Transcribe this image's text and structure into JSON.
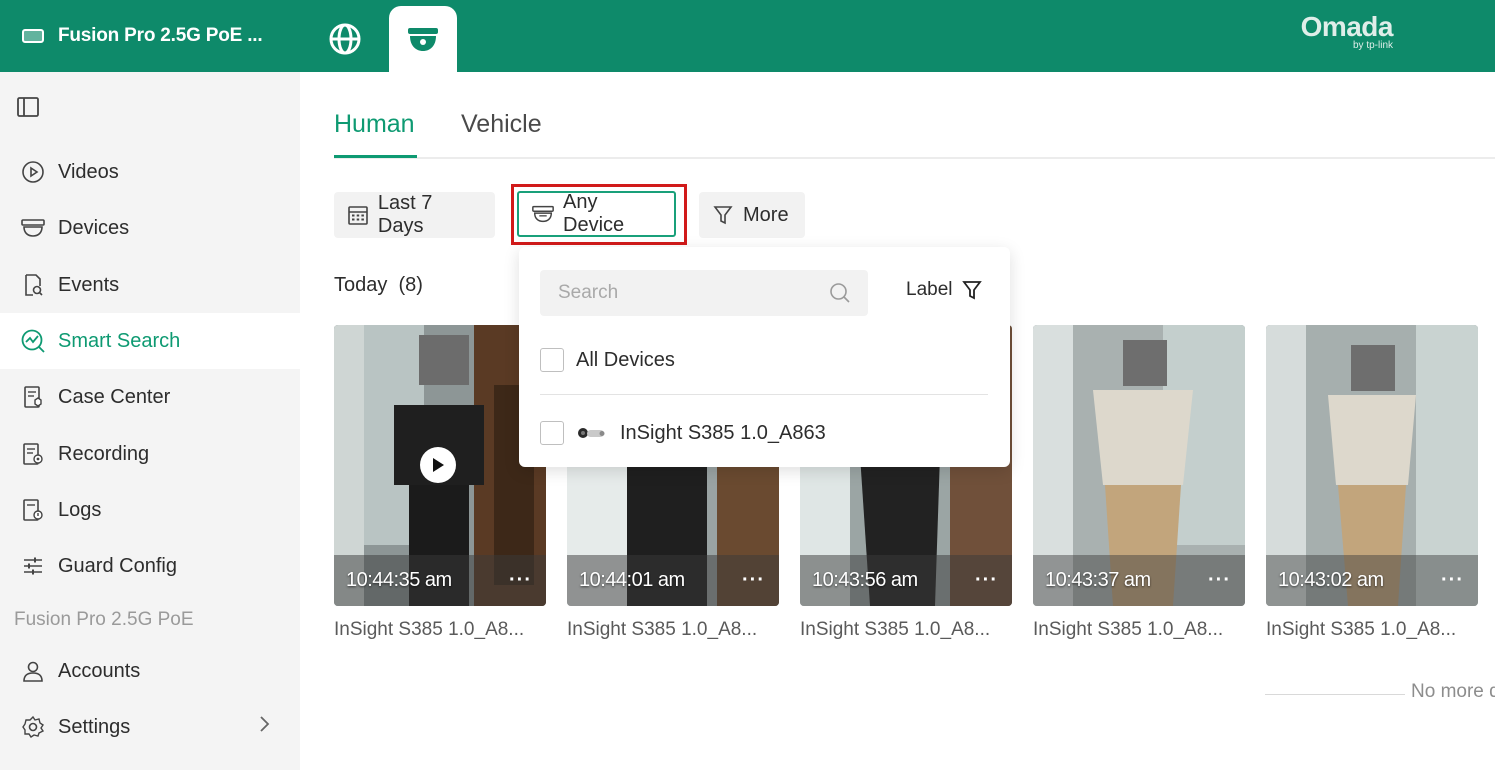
{
  "header": {
    "site_name": "Fusion Pro 2.5G PoE ...",
    "brand_name": "Omada",
    "brand_sub": "by tp-link"
  },
  "sidebar": {
    "items": [
      {
        "label": "Videos",
        "icon": "play-circle-icon"
      },
      {
        "label": "Devices",
        "icon": "camera-icon"
      },
      {
        "label": "Events",
        "icon": "event-search-icon"
      },
      {
        "label": "Smart Search",
        "icon": "smart-search-icon",
        "active": true
      },
      {
        "label": "Case Center",
        "icon": "case-icon"
      },
      {
        "label": "Recording",
        "icon": "recording-icon"
      },
      {
        "label": "Logs",
        "icon": "logs-icon"
      },
      {
        "label": "Guard Config",
        "icon": "sliders-icon"
      }
    ],
    "section_label": "Fusion Pro 2.5G PoE",
    "bottom_items": [
      {
        "label": "Accounts",
        "icon": "user-icon"
      },
      {
        "label": "Settings",
        "icon": "gear-icon"
      }
    ]
  },
  "tabs": [
    {
      "label": "Human",
      "active": true
    },
    {
      "label": "Vehicle",
      "active": false
    }
  ],
  "filters": {
    "date_label": "Last 7 Days",
    "device_label": "Any Device",
    "more_label": "More"
  },
  "today": {
    "label": "Today",
    "count": "(8)"
  },
  "clips": [
    {
      "time": "10:44:35 am",
      "device": "InSight S385 1.0_A8...",
      "more": "···"
    },
    {
      "time": "10:44:01 am",
      "device": "InSight S385 1.0_A8...",
      "more": "···"
    },
    {
      "time": "10:43:56 am",
      "device": "InSight S385 1.0_A8...",
      "more": "···"
    },
    {
      "time": "10:43:37 am",
      "device": "InSight S385 1.0_A8...",
      "more": "···"
    },
    {
      "time": "10:43:02 am",
      "device": "InSight S385 1.0_A8...",
      "more": "···"
    }
  ],
  "no_more": "No more d",
  "device_dropdown": {
    "search_placeholder": "Search",
    "label_filter": "Label",
    "all_devices": "All Devices",
    "devices": [
      "InSight S385 1.0_A863"
    ]
  },
  "colors": {
    "brand_green": "#0e8a6a",
    "accent_green": "#0e9a72",
    "highlight_red": "#d11a1a"
  }
}
